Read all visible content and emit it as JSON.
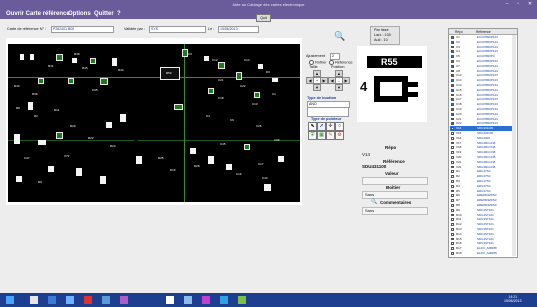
{
  "window": {
    "title": "Aide au Cablage des cartes électronique",
    "minimize": "–",
    "maximize": "▫",
    "close": "✕"
  },
  "menu": {
    "items": [
      "Ouvrir Carte référence",
      "Options",
      "Quitter",
      "?"
    ],
    "quit_button": "Quit"
  },
  "toolbar": {
    "ref_label": "Carte de référence N° :",
    "ref_value": "P262401 B00",
    "validation_label": "Validée par :",
    "validation_value": "SYS",
    "date_label": "Le :",
    "date_value": "15/06/2013"
  },
  "board": {
    "component_labels": [
      "R50",
      "C3",
      "C12",
      "R48",
      "R45",
      "R41",
      "R44",
      "C14",
      "D3",
      "R40",
      "R36",
      "C35",
      "C21",
      "C22",
      "C18",
      "C13",
      "C1",
      "C4",
      "C6",
      "C26",
      "C36",
      "C45",
      "R8",
      "R2",
      "R11",
      "R29",
      "V73",
      "C37",
      "R23",
      "R22",
      "R25",
      "R16",
      "R28",
      "C16",
      "C17",
      "R9",
      "C40"
    ]
  },
  "zoom_panel": {
    "title": "Par lissé",
    "line1": "Larx : 130",
    "line2": "Auli : 10",
    "preview_label": "R55",
    "preview_side": "4"
  },
  "adjust": {
    "title": "Ajustement",
    "value": "2",
    "opt1": "Rother",
    "opt2": "Référence",
    "col1": "Taille",
    "col2": "Position",
    "up": "▲",
    "down": "▼",
    "left": "◀",
    "right": "▶",
    "zoom_in": "+",
    "zoom_out": "–"
  },
  "marker": {
    "type_label": "Type de boutton",
    "type_value": "ANO",
    "pointer_label": "Type de pointeur"
  },
  "info": {
    "repo_label": "Répo",
    "repo_value": "V14",
    "reference_label": "Référence",
    "reference_value": "SDU431100",
    "valeur_label": "Valeur",
    "valeur_value": "",
    "boitier_label": "Boîtier",
    "boitier_value": "Sans",
    "comment_label": "Commentaires",
    "comment_value": "Sans"
  },
  "list": {
    "col_repo": "Répo",
    "col_ref": "Référence",
    "selected_index": 19,
    "rows": [
      {
        "repo": "C1",
        "ref": "ECCP8R0P123",
        "checked": true
      },
      {
        "repo": "C2",
        "ref": "ECCP8R0P123",
        "checked": true
      },
      {
        "repo": "C3",
        "ref": "ECCP8R0P123",
        "checked": true
      },
      {
        "repo": "C4",
        "ref": "ECCP8R0P123",
        "checked": true
      },
      {
        "repo": "C5",
        "ref": "ECCP8R0P3",
        "checked": true
      },
      {
        "repo": "C6",
        "ref": "ECCP8R0P123",
        "checked": true
      },
      {
        "repo": "C7",
        "ref": "ECCP8R0P123",
        "checked": true
      },
      {
        "repo": "C8",
        "ref": "ECCP8R0P123",
        "checked": true
      },
      {
        "repo": "C12",
        "ref": "ECCP8R0P123",
        "checked": true
      },
      {
        "repo": "C13",
        "ref": "ECCP8R0P123",
        "checked": true
      },
      {
        "repo": "C14",
        "ref": "ECCP8R0P123",
        "checked": true
      },
      {
        "repo": "C15",
        "ref": "ECCP8R0P123",
        "checked": true
      },
      {
        "repo": "C16",
        "ref": "ECCP8R0P123",
        "checked": true
      },
      {
        "repo": "C17",
        "ref": "ECCP8R0P123",
        "checked": true
      },
      {
        "repo": "C18",
        "ref": "ECCP8R0P123",
        "checked": true
      },
      {
        "repo": "C19",
        "ref": "ECCP8R0P123",
        "checked": true
      },
      {
        "repo": "C20",
        "ref": "ECCP8R0P123",
        "checked": true
      },
      {
        "repo": "C21",
        "ref": "ECCP8R0P123",
        "checked": true
      },
      {
        "repo": "C22",
        "ref": "ECCP8R0P123",
        "checked": true
      },
      {
        "repo": "V14",
        "ref": "SDU431100",
        "checked": false
      },
      {
        "repo": "V15",
        "ref": "SDU431100",
        "checked": false
      },
      {
        "repo": "V16",
        "ref": "SDU4300",
        "checked": false
      },
      {
        "repo": "V17",
        "ref": "SDU4RCCN8",
        "checked": false
      },
      {
        "repo": "V18",
        "ref": "SDU4RCCN8",
        "checked": false
      },
      {
        "repo": "V19",
        "ref": "SDU4RCCN8",
        "checked": false
      },
      {
        "repo": "V20",
        "ref": "SDU4RCCN8",
        "checked": false
      },
      {
        "repo": "V21",
        "ref": "SDU4RCCN8",
        "checked": false
      },
      {
        "repo": "V22",
        "ref": "SDU4RCCN8",
        "checked": false
      },
      {
        "repo": "R1",
        "ref": "ERU47SC",
        "checked": false
      },
      {
        "repo": "R2",
        "ref": "ERU47SC",
        "checked": false
      },
      {
        "repo": "R3",
        "ref": "ERU47SC",
        "checked": false
      },
      {
        "repo": "R4",
        "ref": "ERU47SC",
        "checked": false
      },
      {
        "repo": "R5",
        "ref": "ERU47SC",
        "checked": false
      },
      {
        "repo": "R6",
        "ref": "ERE8M32RS3",
        "checked": false
      },
      {
        "repo": "R7",
        "ref": "ERE8M32RS3",
        "checked": false
      },
      {
        "repo": "R8",
        "ref": "ERE8M32RS3",
        "checked": false
      },
      {
        "repo": "R9",
        "ref": "SDU4ST101",
        "checked": false
      },
      {
        "repo": "R10",
        "ref": "SDU4ST101",
        "checked": false
      },
      {
        "repo": "R11",
        "ref": "SDU4ST101",
        "checked": false
      },
      {
        "repo": "R12",
        "ref": "SDU4ST101",
        "checked": false
      },
      {
        "repo": "R13",
        "ref": "SDU4ST101",
        "checked": false
      },
      {
        "repo": "R14",
        "ref": "SDU4ST101",
        "checked": false
      },
      {
        "repo": "R15",
        "ref": "SDU4ST101",
        "checked": false
      },
      {
        "repo": "R16",
        "ref": "SDU4ST101",
        "checked": false
      },
      {
        "repo": "R17",
        "ref": "ELDC_AMR88",
        "checked": false
      },
      {
        "repo": "R18",
        "ref": "ELDC_AMR88",
        "checked": false
      },
      {
        "repo": "R19",
        "ref": "ERCS8R100",
        "checked": false
      }
    ]
  },
  "taskbar": {
    "clock": "14:21",
    "date": "15/06/2013"
  }
}
